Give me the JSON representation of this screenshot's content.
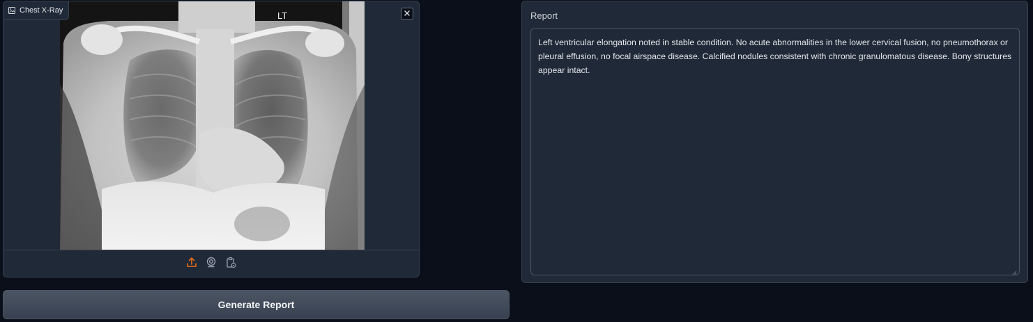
{
  "image_input": {
    "label": "Chest X-Ray",
    "label_icon": "image-icon",
    "marker_text": "LT",
    "close_icon": "close-icon",
    "sources": [
      {
        "name": "upload-icon",
        "color": "#f97316",
        "active": true
      },
      {
        "name": "webcam-icon",
        "color": "#9ca3af",
        "active": false
      },
      {
        "name": "clipboard-icon",
        "color": "#9ca3af",
        "active": false
      }
    ]
  },
  "actions": {
    "generate_label": "Generate Report"
  },
  "report": {
    "label": "Report",
    "text": "Left ventricular elongation noted in stable condition. No acute abnormalities in the lower cervical fusion, no pneumothorax or pleural effusion, no focal airspace disease. Calcified nodules consistent with chronic granulomatous disease. Bony structures appear intact."
  },
  "colors": {
    "background": "#0b0f19",
    "panel": "#1f2937",
    "border": "#374151",
    "accent": "#f97316"
  }
}
